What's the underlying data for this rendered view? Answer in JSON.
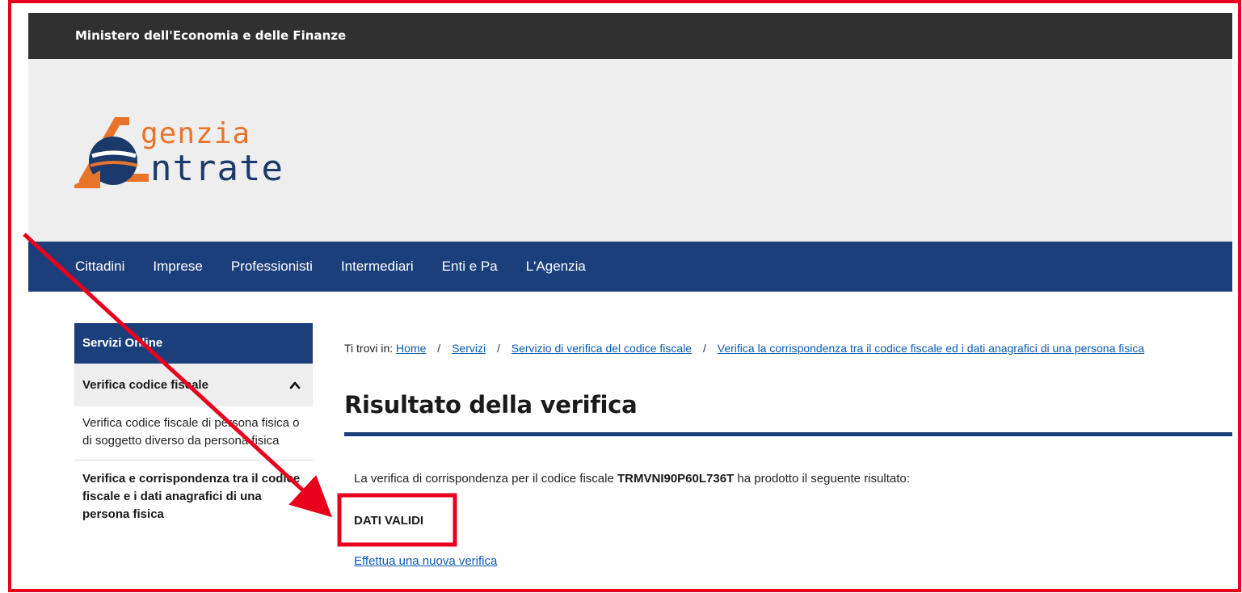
{
  "top_bar": {
    "label": "Ministero dell'Economia e delle Finanze"
  },
  "logo": {
    "line1": "genzia",
    "line2": "ntrate"
  },
  "nav": {
    "items": [
      "Cittadini",
      "Imprese",
      "Professionisti",
      "Intermediari",
      "Enti e Pa",
      "L'Agenzia"
    ]
  },
  "sidebar": {
    "title": "Servizi Online",
    "section": "Verifica codice fiscale",
    "items": [
      "Verifica codice fiscale di persona fisica o di soggetto diverso da persona fisica",
      "Verifica e corrispondenza tra il codice fiscale e i dati anagrafici di una persona fisica"
    ]
  },
  "breadcrumb": {
    "prefix": "Ti trovi in:",
    "items": [
      "Home",
      "Servizi",
      "Servizio di verifica del codice fiscale",
      "Verifica la corrispondenza tra il codice fiscale ed i dati anagrafici di una persona fisica"
    ]
  },
  "main": {
    "title": "Risultato della verifica",
    "result_prefix": "La verifica di corrispondenza per il codice fiscale",
    "codice_fiscale": "TRMVNI90P60L736T",
    "result_suffix": "ha prodotto il seguente risultato:",
    "status": "DATI VALIDI",
    "new_check_link": "Effettua una nuova verifica"
  },
  "colors": {
    "top_bar": "#303030",
    "nav": "#1b3f7b",
    "logo_orange": "#e8742a",
    "logo_blue": "#1b3a6b",
    "annotation_red": "#e8001c",
    "link": "#0b5bb5"
  },
  "icons": {
    "chevron": "chevron-up-icon",
    "logo_mark": "agenzia-entrate-logo-icon"
  }
}
